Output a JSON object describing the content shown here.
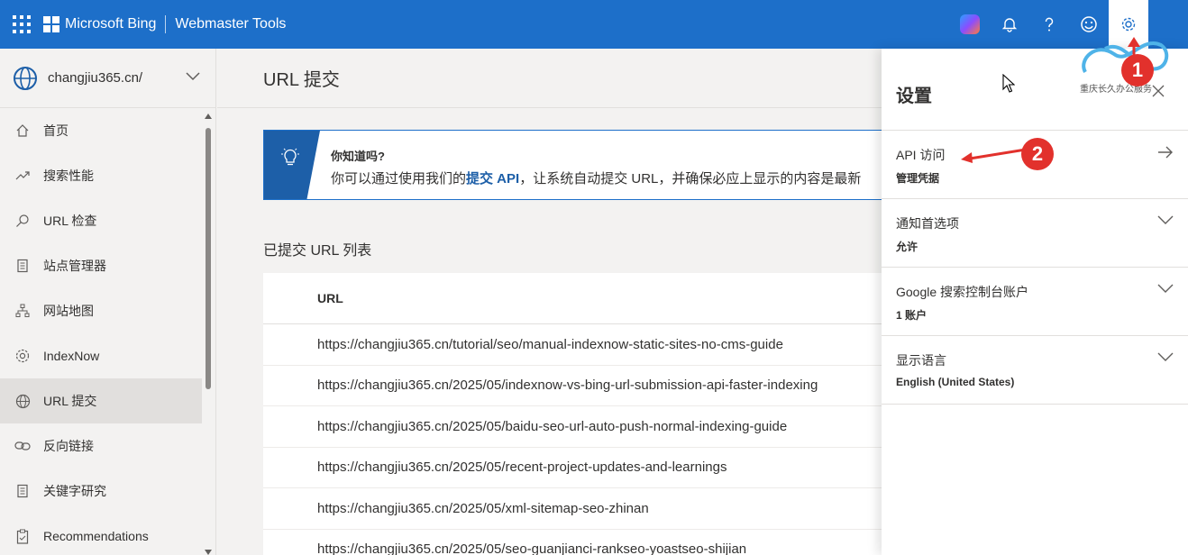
{
  "topbar": {
    "brand": "Microsoft Bing",
    "product": "Webmaster Tools",
    "icons": [
      "apps-icon",
      "copilot-icon",
      "bell-icon",
      "help-icon",
      "smiley-icon",
      "gear-icon"
    ],
    "colors": {
      "bar": "#1d6fc9",
      "active": "#ffffff"
    }
  },
  "sidebar": {
    "site": "changjiu365.cn/",
    "items": [
      {
        "label": "首页",
        "icon": "home-icon"
      },
      {
        "label": "搜索性能",
        "icon": "trend-icon"
      },
      {
        "label": "URL 检查",
        "icon": "search-icon"
      },
      {
        "label": "站点管理器",
        "icon": "document-icon"
      },
      {
        "label": "网站地图",
        "icon": "sitemap-icon"
      },
      {
        "label": "IndexNow",
        "icon": "gear-icon"
      },
      {
        "label": "URL 提交",
        "icon": "globe-icon",
        "active": true
      },
      {
        "label": "反向链接",
        "icon": "link-icon"
      },
      {
        "label": "关键字研究",
        "icon": "document-icon"
      },
      {
        "label": "Recommendations",
        "icon": "clipboard-icon"
      }
    ]
  },
  "main": {
    "title": "URL 提交",
    "tip": {
      "title": "你知道吗?",
      "text_before": "你可以通过使用我们的",
      "link": "提交 API",
      "text_after": "，让系统自动提交 URL，并确保必应上显示的内容是最新"
    },
    "list_title": "已提交 URL 列表",
    "table": {
      "header": "URL",
      "rows": [
        "https://changjiu365.cn/tutorial/seo/manual-indexnow-static-sites-no-cms-guide",
        "https://changjiu365.cn/2025/05/indexnow-vs-bing-url-submission-api-faster-indexing",
        "https://changjiu365.cn/2025/05/baidu-seo-url-auto-push-normal-indexing-guide",
        "https://changjiu365.cn/2025/05/recent-project-updates-and-learnings",
        "https://changjiu365.cn/2025/05/xml-sitemap-seo-zhinan",
        "https://changjiu365.cn/2025/05/seo-guanjianci-rankseo-yoastseo-shijian"
      ]
    }
  },
  "settings": {
    "title": "设置",
    "sections": [
      {
        "label": "API 访问",
        "value": "管理凭据",
        "arrow": "arrow-right-icon"
      },
      {
        "label": "通知首选项",
        "value": "允许",
        "arrow": "chevron-down-icon"
      },
      {
        "label": "Google 搜索控制台账户",
        "value": "1 账户",
        "arrow": "chevron-down-icon"
      },
      {
        "label": "显示语言",
        "value": "English (United States)",
        "arrow": "chevron-down-icon"
      }
    ]
  },
  "annotations": {
    "badge1": "1",
    "badge2": "2",
    "color": "#e2312c"
  },
  "watermark": {
    "text": "重庆长久办公服务"
  }
}
